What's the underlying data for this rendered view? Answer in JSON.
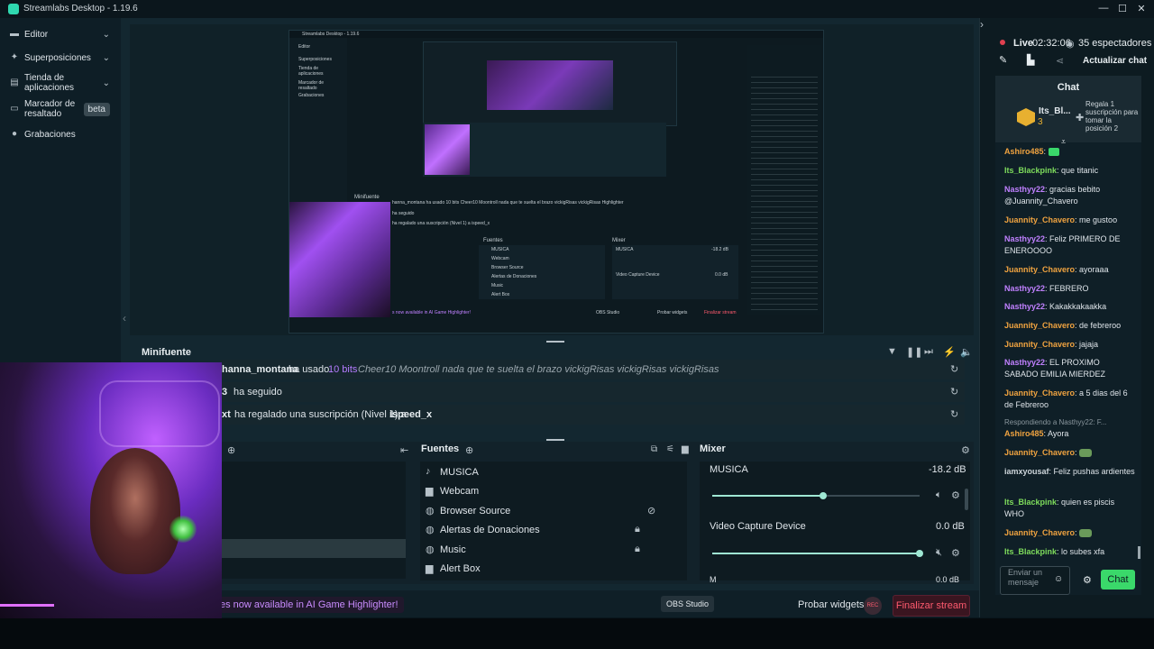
{
  "app": {
    "title": "Streamlabs Desktop - 1.19.6",
    "minimize_glyph": "—",
    "maximize_glyph": "☐",
    "close_glyph": "✕"
  },
  "sidebar": {
    "items": [
      {
        "label": "Editor",
        "icon": "editor-icon"
      },
      {
        "label": "Superposiciones",
        "icon": "overlays-icon"
      },
      {
        "label": "Tienda de aplicaciones",
        "icon": "store-icon"
      },
      {
        "label": "Marcador de resaltado",
        "icon": "highlighter-icon",
        "badge": "beta"
      },
      {
        "label": "Grabaciones",
        "icon": "recordings-icon"
      }
    ]
  },
  "preview": {
    "inner_title": "Streamlabs Desktop - 1.19.6",
    "inner_nav": [
      "Editor",
      "Superposiciones",
      "Tienda de aplicaciones",
      "Marcador de resaltado",
      "Grabaciones"
    ],
    "inner_minifuente": "Minifuente",
    "inner_fuentes": "Fuentes",
    "inner_mixer": "Mixer",
    "inner_sources": [
      "MUSICA",
      "Webcam",
      "Browser Source",
      "Alertas de Donaciones",
      "Music",
      "Alert Box"
    ],
    "inner_mixer_items": [
      "MUSICA",
      "Video Capture Device"
    ],
    "inner_mixer_db": [
      "-18.2 dB",
      "0.0 dB"
    ],
    "inner_events": [
      "hanna_montana ha usado 10 bits Cheer10 Moontroll nada que te suelta el brazo vickigRisas vickigRisas Highlighter",
      "ha seguido",
      "ha regalado una suscripción (Nivel 1) a ispeed_x"
    ],
    "inner_footer_promo": "s now available in AI Game Highlighter!",
    "inner_obs": "OBS Studio",
    "inner_probar": "Probar widgets",
    "inner_finalizar": "Finalizar stream"
  },
  "minifuente": {
    "title": "Minifuente",
    "events": [
      {
        "user": "hanna_montana",
        "action": "ha usado",
        "amount": "10 bits",
        "message": "Cheer10 Moontroll nada que te suelta el brazo vickigRisas vickigRisas vickigRisas"
      },
      {
        "user": "3",
        "action": "ha seguido"
      },
      {
        "user": "xt",
        "action": "ha regalado una suscripción (Nivel 1) a",
        "target": "ispeed_x"
      }
    ]
  },
  "fuentes": {
    "title": "Fuentes",
    "items": [
      {
        "label": "MUSICA",
        "icon": "music-icon"
      },
      {
        "label": "Webcam",
        "icon": "folder-icon"
      },
      {
        "label": "Browser Source",
        "icon": "globe-icon",
        "state": "eye-off-icon"
      },
      {
        "label": "Alertas de Donaciones",
        "icon": "globe-icon",
        "state": "lock-icon"
      },
      {
        "label": "Music",
        "icon": "globe-icon",
        "state": "lock-icon"
      },
      {
        "label": "Alert Box",
        "icon": "folder-icon"
      }
    ]
  },
  "mixer": {
    "title": "Mixer",
    "channels": [
      {
        "name": "MUSICA",
        "db": "-18.2 dB",
        "level": 0.53
      },
      {
        "name": "Video Capture Device",
        "db": "0.0 dB",
        "level": 1.0
      },
      {
        "name": "M",
        "db": "0.0 dB"
      }
    ]
  },
  "footer": {
    "promo": "es now available in AI Game Highlighter!",
    "obs_button": "OBS Studio",
    "probar": "Probar widgets",
    "rec": "REC",
    "finalizar": "Finalizar stream"
  },
  "chat": {
    "live_label": "Live",
    "live_time": "02:32:06",
    "viewers": "35 espectadores",
    "refresh_label": "Actualizar chat",
    "header": "Chat",
    "top_user": "Its_Bl...",
    "top_rank": "3",
    "sub_prompt": "Regala 1 suscripción para tomar la posición 2",
    "messages": [
      {
        "user": "Ashiro485",
        "color": "o",
        "text": ""
      },
      {
        "user": "Its_Blackpink",
        "color": "g",
        "text": "que titanic"
      },
      {
        "user": "Nasthyy22",
        "color": "p",
        "text": "gracias bebito @Juannity_Chavero"
      },
      {
        "user": "Juannity_Chavero",
        "color": "o",
        "text": "me gustoo"
      },
      {
        "user": "Nasthyy22",
        "color": "p",
        "text": "Feliz PRIMERO DE ENEROOOO"
      },
      {
        "user": "Juannity_Chavero",
        "color": "o",
        "text": "ayoraaa"
      },
      {
        "user": "Nasthyy22",
        "color": "p",
        "text": "FEBRERO"
      },
      {
        "user": "Nasthyy22",
        "color": "p",
        "text": "Kakakkakaakka"
      },
      {
        "user": "Juannity_Chavero",
        "color": "o",
        "text": "de febreroo"
      },
      {
        "user": "Juannity_Chavero",
        "color": "o",
        "text": "jajaja"
      },
      {
        "user": "Nasthyy22",
        "color": "p",
        "text": "EL PROXIMO SABADO EMILIA MIERDEZ"
      },
      {
        "user": "Juannity_Chavero",
        "color": "o",
        "text": "a 5 dias del 6 de Febreroo"
      },
      {
        "user": "Ashiro485",
        "color": "o",
        "text": "Ayora",
        "reply": "Respondiendo a Nasthyy22: F..."
      },
      {
        "user": "Juannity_Chavero",
        "color": "o",
        "text": ""
      },
      {
        "user": "iamxyousaf",
        "color": "w",
        "text": "Feliz pushas ardientes"
      },
      {
        "user": "Its_Blackpink",
        "color": "g",
        "text": "quien es piscis WHO"
      },
      {
        "user": "Juannity_Chavero",
        "color": "o",
        "text": ""
      },
      {
        "user": "Its_Blackpink",
        "color": "g",
        "text": "lo subes xfa"
      }
    ],
    "input_placeholder": "Enviar un mensaje",
    "send_label": "Chat"
  },
  "colors": {
    "accent": "#31c3a2",
    "live_red": "#e04050",
    "chat_green": "#3ad86a"
  }
}
